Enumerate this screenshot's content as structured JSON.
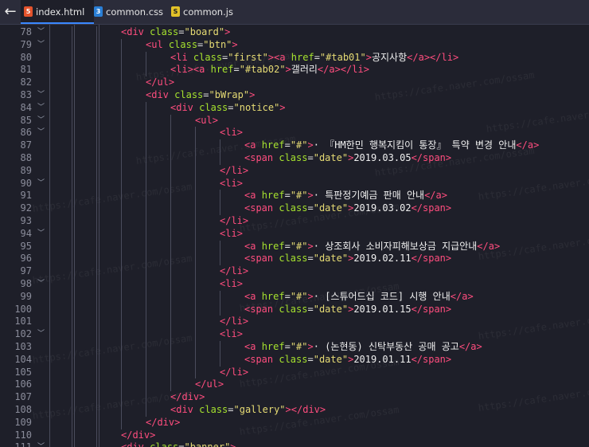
{
  "tabs": [
    {
      "label": "index.html",
      "icon": "html5-icon",
      "icon_glyph": "5",
      "active": true
    },
    {
      "label": "common.css",
      "icon": "css3-icon",
      "icon_glyph": "3",
      "active": false
    },
    {
      "label": "common.js",
      "icon": "js-icon",
      "icon_glyph": "S",
      "active": false
    }
  ],
  "back_icon": "←",
  "watermark": "https://cafe.naver.com/ossam",
  "colors": {
    "tag": "#ff4d7e",
    "attr": "#a6e22e",
    "string": "#e6db74",
    "text": "#f0f0f0",
    "background": "#1e1f29",
    "line_number": "#8a8c9a"
  },
  "lines": [
    {
      "n": "78",
      "fold": true,
      "indent": 4,
      "code": "<div class=\"board\">"
    },
    {
      "n": "79",
      "fold": true,
      "indent": 5,
      "code": "<ul class=\"btn\">"
    },
    {
      "n": "80",
      "fold": false,
      "indent": 6,
      "code": "<li class=\"first\"><a href=\"#tab01\">공지사항</a></li>"
    },
    {
      "n": "81",
      "fold": false,
      "indent": 6,
      "code": "<li><a href=\"#tab02\">갤러리</a></li>"
    },
    {
      "n": "82",
      "fold": false,
      "indent": 5,
      "code": "</ul>"
    },
    {
      "n": "83",
      "fold": true,
      "indent": 5,
      "code": "<div class=\"bWrap\">"
    },
    {
      "n": "84",
      "fold": true,
      "indent": 6,
      "code": "<div class=\"notice\">"
    },
    {
      "n": "85",
      "fold": true,
      "indent": 7,
      "code": "<ul>"
    },
    {
      "n": "86",
      "fold": true,
      "indent": 8,
      "code": "<li>"
    },
    {
      "n": "87",
      "fold": false,
      "indent": 9,
      "code": "<a href=\"#\">· 『HM한민 행복지킴이 통장』 특약 변경 안내</a>"
    },
    {
      "n": "88",
      "fold": false,
      "indent": 9,
      "code": "<span class=\"date\">2019.03.05</span>"
    },
    {
      "n": "89",
      "fold": false,
      "indent": 8,
      "code": "</li>"
    },
    {
      "n": "90",
      "fold": true,
      "indent": 8,
      "code": "<li>"
    },
    {
      "n": "91",
      "fold": false,
      "indent": 9,
      "code": "<a href=\"#\">· 특판정기예금 판매 안내</a>"
    },
    {
      "n": "92",
      "fold": false,
      "indent": 9,
      "code": "<span class=\"date\">2019.03.02</span>"
    },
    {
      "n": "93",
      "fold": false,
      "indent": 8,
      "code": "</li>"
    },
    {
      "n": "94",
      "fold": true,
      "indent": 8,
      "code": "<li>"
    },
    {
      "n": "95",
      "fold": false,
      "indent": 9,
      "code": "<a href=\"#\">· 상조회사 소비자피해보상금 지급안내</a>"
    },
    {
      "n": "96",
      "fold": false,
      "indent": 9,
      "code": "<span class=\"date\">2019.02.11</span>"
    },
    {
      "n": "97",
      "fold": false,
      "indent": 8,
      "code": "</li>"
    },
    {
      "n": "98",
      "fold": true,
      "indent": 8,
      "code": "<li>"
    },
    {
      "n": "99",
      "fold": false,
      "indent": 9,
      "code": "<a href=\"#\">· [스튜어드십 코드] 시행 안내</a>"
    },
    {
      "n": "100",
      "fold": false,
      "indent": 9,
      "code": "<span class=\"date\">2019.01.15</span>"
    },
    {
      "n": "101",
      "fold": false,
      "indent": 8,
      "code": "</li>"
    },
    {
      "n": "102",
      "fold": true,
      "indent": 8,
      "code": "<li>"
    },
    {
      "n": "103",
      "fold": false,
      "indent": 9,
      "code": "<a href=\"#\">· (논현동) 신탁부동산 공매 공고</a>"
    },
    {
      "n": "104",
      "fold": false,
      "indent": 9,
      "code": "<span class=\"date\">2019.01.11</span>"
    },
    {
      "n": "105",
      "fold": false,
      "indent": 8,
      "code": "</li>"
    },
    {
      "n": "106",
      "fold": false,
      "indent": 7,
      "code": "</ul>"
    },
    {
      "n": "107",
      "fold": false,
      "indent": 6,
      "code": "</div>"
    },
    {
      "n": "108",
      "fold": false,
      "indent": 6,
      "code": "<div class=\"gallery\"></div>"
    },
    {
      "n": "109",
      "fold": false,
      "indent": 5,
      "code": "</div>"
    },
    {
      "n": "110",
      "fold": false,
      "indent": 4,
      "code": "</div>"
    },
    {
      "n": "111",
      "fold": true,
      "indent": 4,
      "code": "<div class=\"banner\">"
    }
  ]
}
